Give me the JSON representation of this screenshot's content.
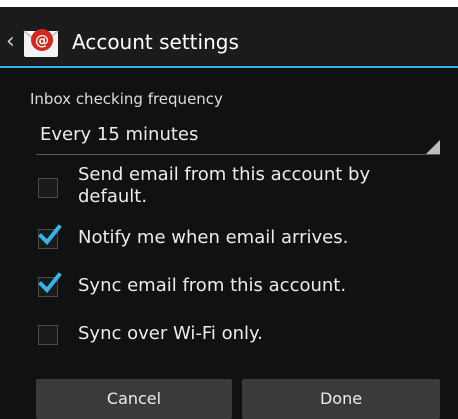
{
  "app_bar": {
    "title": "Account settings",
    "icon": "email-app-icon",
    "up_icon": "chevron-left-icon",
    "accent_color": "#33b5e5"
  },
  "inbox_frequency": {
    "label": "Inbox checking frequency",
    "selected": "Every 15 minutes"
  },
  "options": [
    {
      "label": "Send email from this account by default.",
      "checked": false
    },
    {
      "label": "Notify me when email arrives.",
      "checked": true
    },
    {
      "label": "Sync email from this account.",
      "checked": true
    },
    {
      "label": "Sync over Wi-Fi only.",
      "checked": false
    }
  ],
  "buttons": {
    "cancel": "Cancel",
    "done": "Done"
  }
}
